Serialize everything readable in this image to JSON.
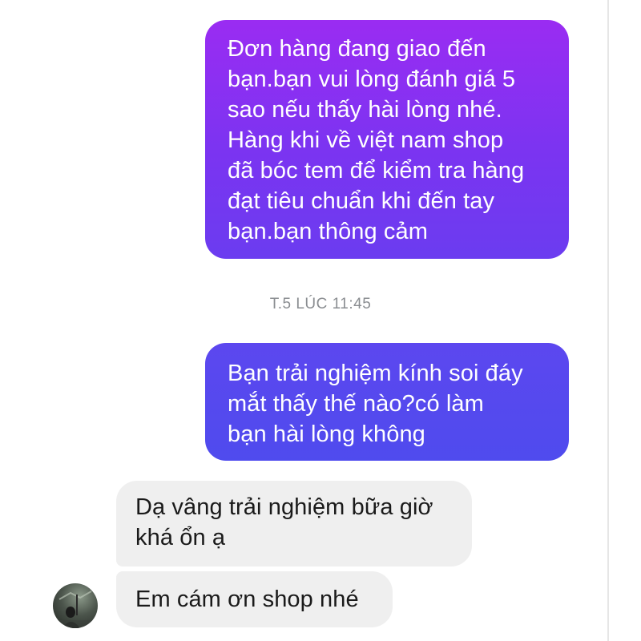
{
  "conversation": {
    "messages": [
      {
        "direction": "outgoing",
        "text": "Đơn hàng đang giao đến\nbạn.bạn vui lòng đánh giá 5\nsao nếu thấy hài lòng nhé.\nHàng khi về việt nam shop\nđã bóc tem để kiểm tra hàng\nđạt tiêu chuẩn khi đến tay\nbạn.bạn thông cảm"
      },
      {
        "direction": "outgoing",
        "text": "Bạn trải nghiệm kính soi đáy\nmắt thấy thế nào?có làm\nbạn hài lòng không"
      },
      {
        "direction": "incoming",
        "text": "Dạ vâng trải nghiệm bữa giờ\nkhá ổn ạ"
      },
      {
        "direction": "incoming",
        "text": "Em cám ơn shop nhé"
      }
    ],
    "timestamp": "T.5 LÚC 11:45"
  },
  "colors": {
    "outgoing_gradient_top": "#9a2cf2",
    "outgoing_gradient_bottom": "#4f4bee",
    "incoming_bubble": "#efefef",
    "timestamp_text": "#8a8d91"
  },
  "icons": {
    "avatar": "contact-avatar-photo"
  }
}
